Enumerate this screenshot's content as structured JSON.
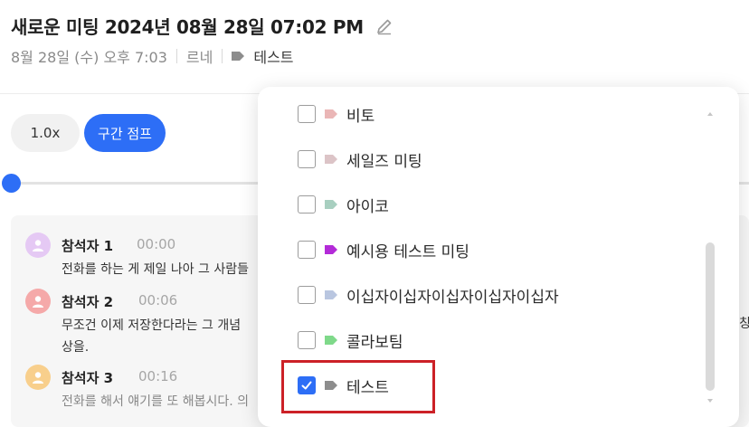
{
  "header": {
    "title": "새로운 미팅 2024년 08월 28일 07:02 PM",
    "date": "8월 28일 (수) 오후 7:03",
    "owner": "르네",
    "tag": {
      "label": "테스트",
      "color": "#8d8d8d"
    }
  },
  "controls": {
    "speed_label": "1.0x",
    "jump_label": "구간 점프"
  },
  "player": {
    "progress": 0.0
  },
  "transcript": {
    "entries": [
      {
        "speaker": "참석자 1",
        "time": "00:00",
        "avatar_color": "#e5c9f4",
        "lines": [
          "전화를 하는 게 제일 나아 그 사람들"
        ]
      },
      {
        "speaker": "참석자 2",
        "time": "00:06",
        "avatar_color": "#f5a9a9",
        "lines": [
          "무조건 이제 저장한다라는 그 개념",
          "상을."
        ]
      },
      {
        "speaker": "참석자 3",
        "time": "00:16",
        "avatar_color": "#f8cf8c",
        "lines": [
          "전화를 해서 얘기를 또 해봅시다. 의"
        ]
      }
    ],
    "cut_char": "칭"
  },
  "tag_dropdown": {
    "options": [
      {
        "label": "비토",
        "color": "#eab6b6",
        "checked": false
      },
      {
        "label": "세일즈 미팅",
        "color": "#dcc4c7",
        "checked": false
      },
      {
        "label": "아이코",
        "color": "#a8cfc0",
        "checked": false
      },
      {
        "label": "예시용 테스트 미팅",
        "color": "#b32bd8",
        "checked": false
      },
      {
        "label": "이십자이십자이십자이십자이십자",
        "color": "#b9c6e0",
        "checked": false
      },
      {
        "label": "콜라보팀",
        "color": "#7fd98a",
        "checked": false
      },
      {
        "label": "테스트",
        "color": "#8d8d8d",
        "checked": true
      }
    ],
    "highlight_color": "#cc2127"
  },
  "colors": {
    "accent": "#2d6ef6"
  }
}
